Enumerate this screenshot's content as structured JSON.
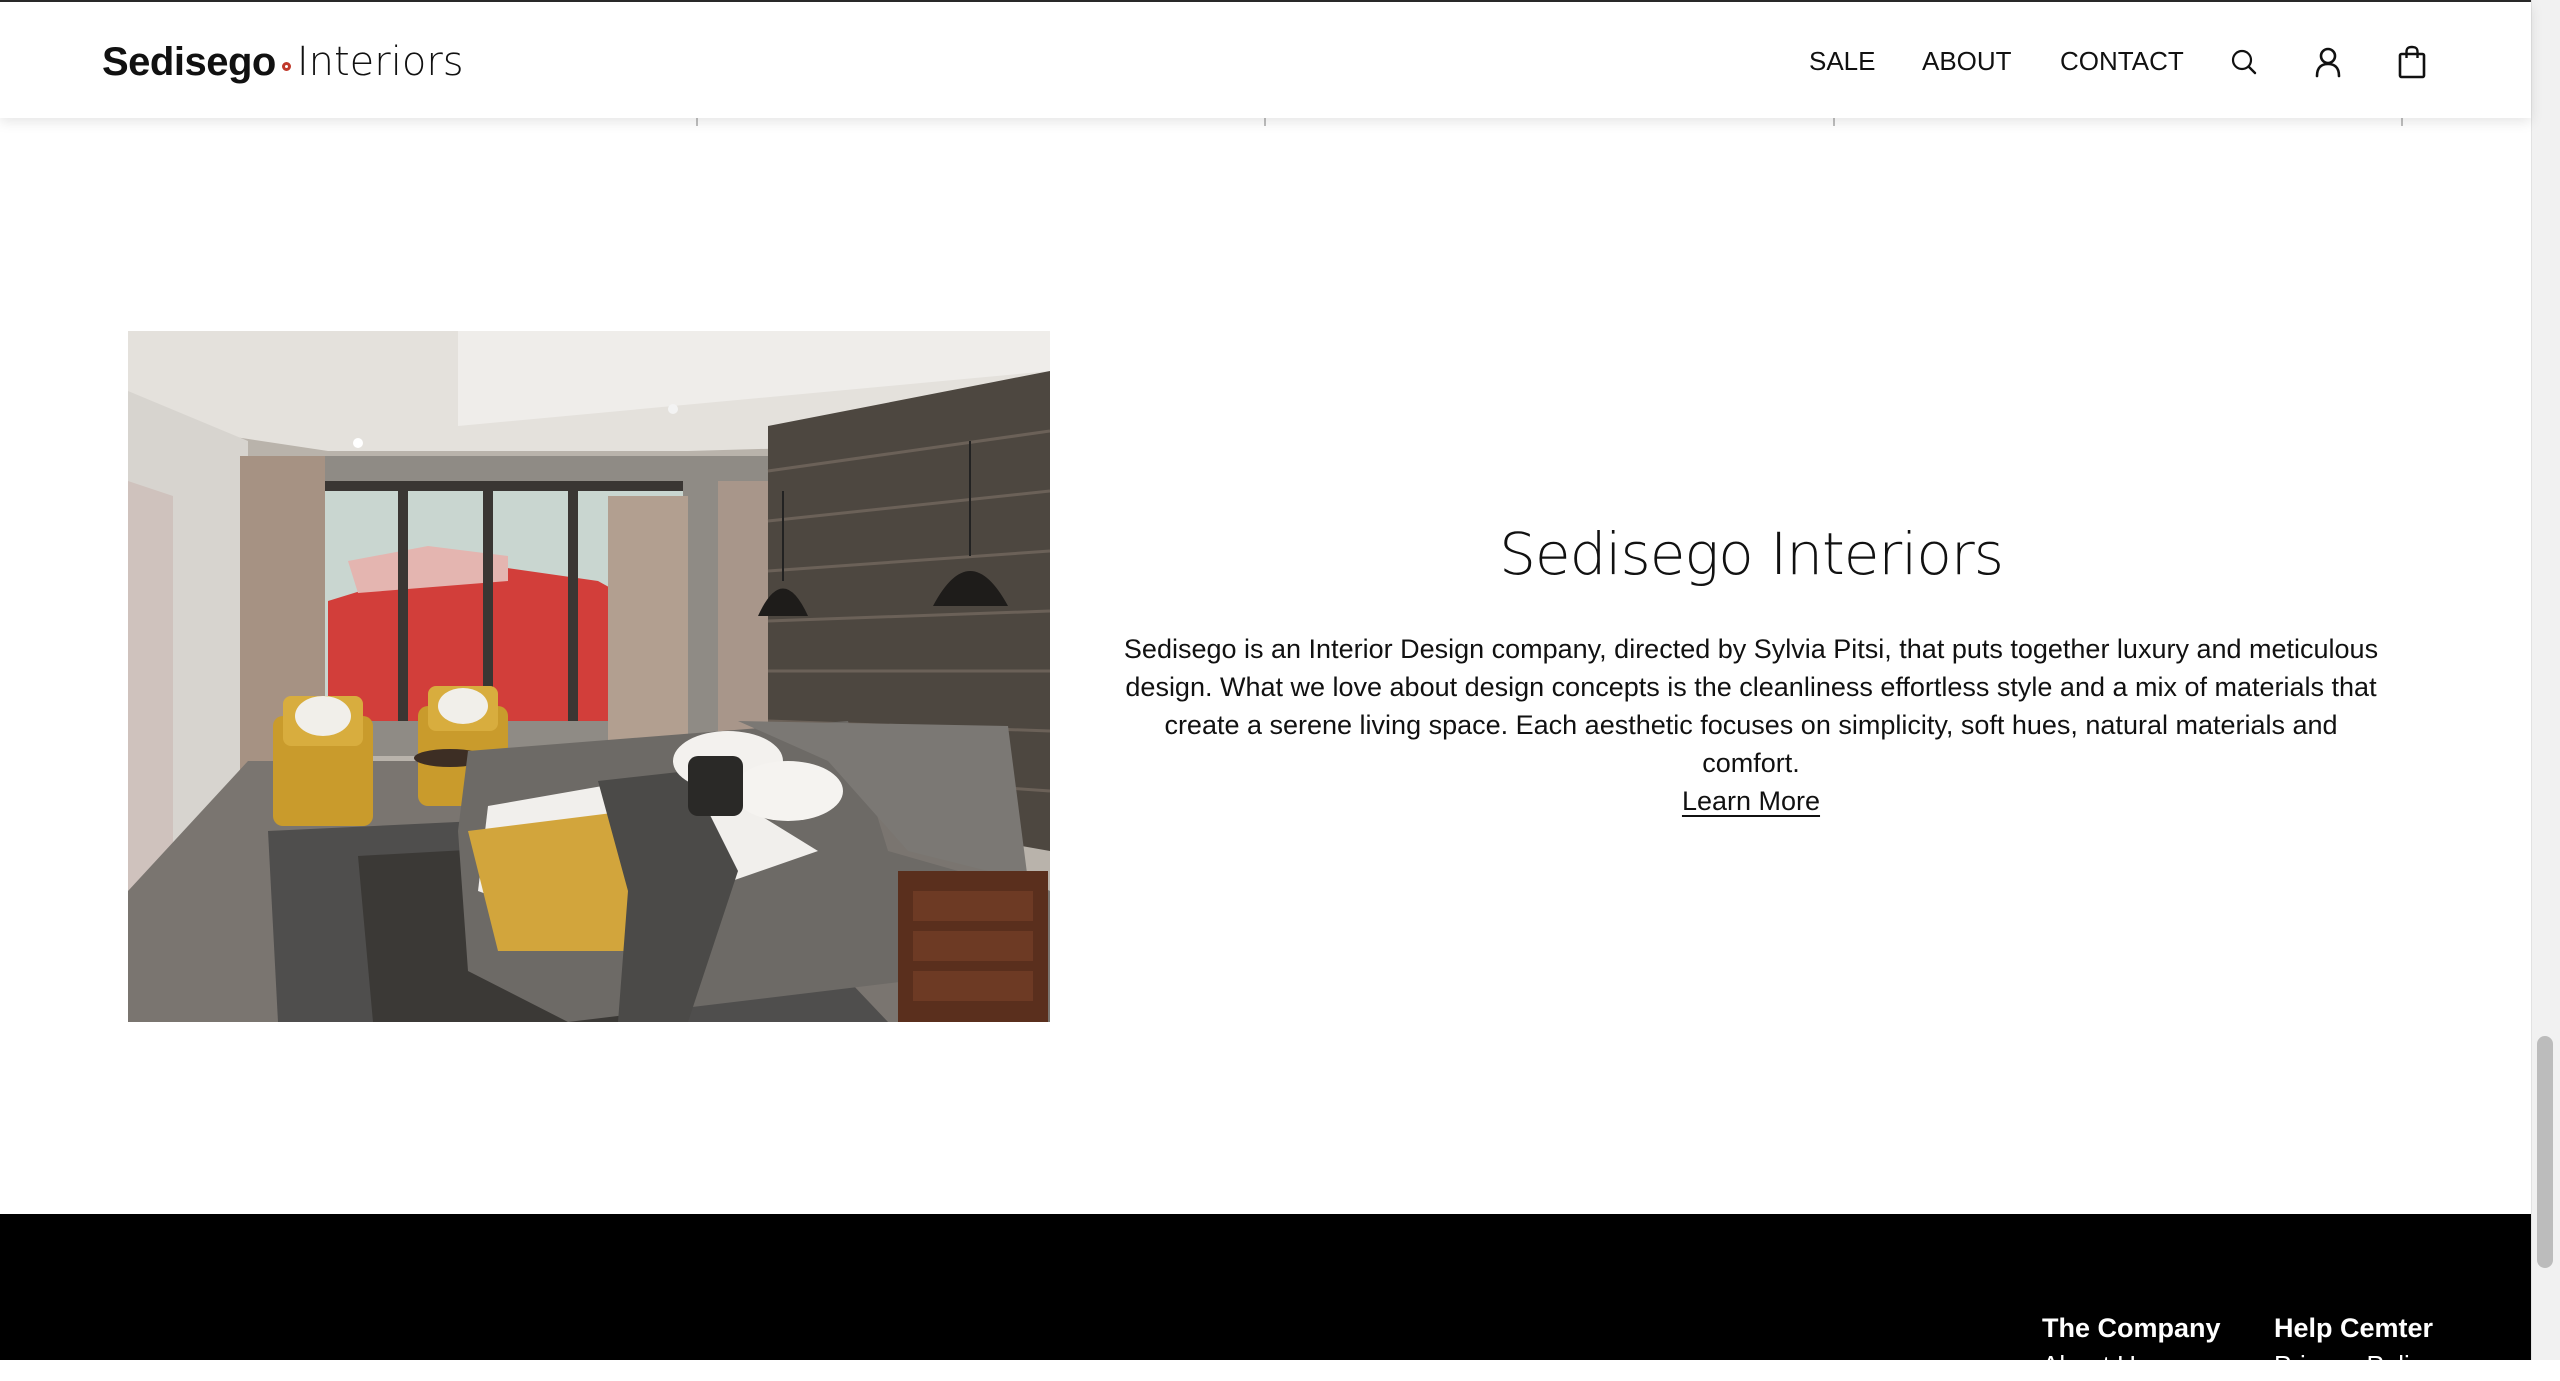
{
  "brand": {
    "logo_primary": "Sedisego",
    "logo_secondary": "Interiors",
    "dot_color": "#c0392b"
  },
  "nav": {
    "items": [
      "SALE",
      "ABOUT",
      "CONTACT"
    ],
    "icons": [
      "search-icon",
      "account-icon",
      "cart-icon"
    ]
  },
  "about": {
    "image_alt": "Bedroom interior with yellow armchairs, grey bed and stone feature wall",
    "title": "Sedisego Interiors",
    "body": "Sedisego is an Interior Design company, directed by Sylvia Pitsi, that puts together luxury and meticulous design. What we love about design concepts is the cleanliness effortless style and a mix of materials that create a serene living space. Each aesthetic focuses on simplicity, soft hues, natural materials and comfort.",
    "cta": "Learn More"
  },
  "footer": {
    "columns": [
      {
        "title": "The Company",
        "link": "About Us"
      },
      {
        "title": "Help Cemter",
        "link": "Privacy Policy"
      }
    ]
  },
  "colors": {
    "footer_bg": "#000000",
    "accent": "#c0392b"
  }
}
